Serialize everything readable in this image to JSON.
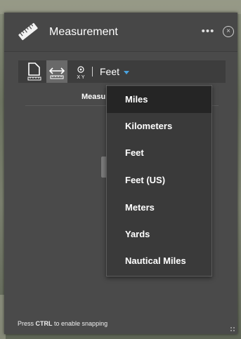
{
  "widget": {
    "title": "Measurement",
    "more_glyph": "•••",
    "close_glyph": "×"
  },
  "toolbar": {
    "tools": [
      {
        "name": "area",
        "icon": "area-icon"
      },
      {
        "name": "distance",
        "icon": "distance-icon",
        "active": true
      },
      {
        "name": "location",
        "icon": "location-xy-icon",
        "caption": "X Y"
      }
    ],
    "unit_selected": "Feet"
  },
  "result": {
    "label": "Measu"
  },
  "dropdown": {
    "options": [
      "Miles",
      "Kilometers",
      "Feet",
      "Feet (US)",
      "Meters",
      "Yards",
      "Nautical Miles"
    ],
    "highlighted": "Miles"
  },
  "footer": {
    "prefix": "Press ",
    "key": "CTRL",
    "suffix": " to enable snapping"
  },
  "colors": {
    "panel": "#4a4a4a",
    "accent": "#4aa3df",
    "dropdown_bg": "#3a3a3a",
    "highlight_bg": "#252525"
  }
}
